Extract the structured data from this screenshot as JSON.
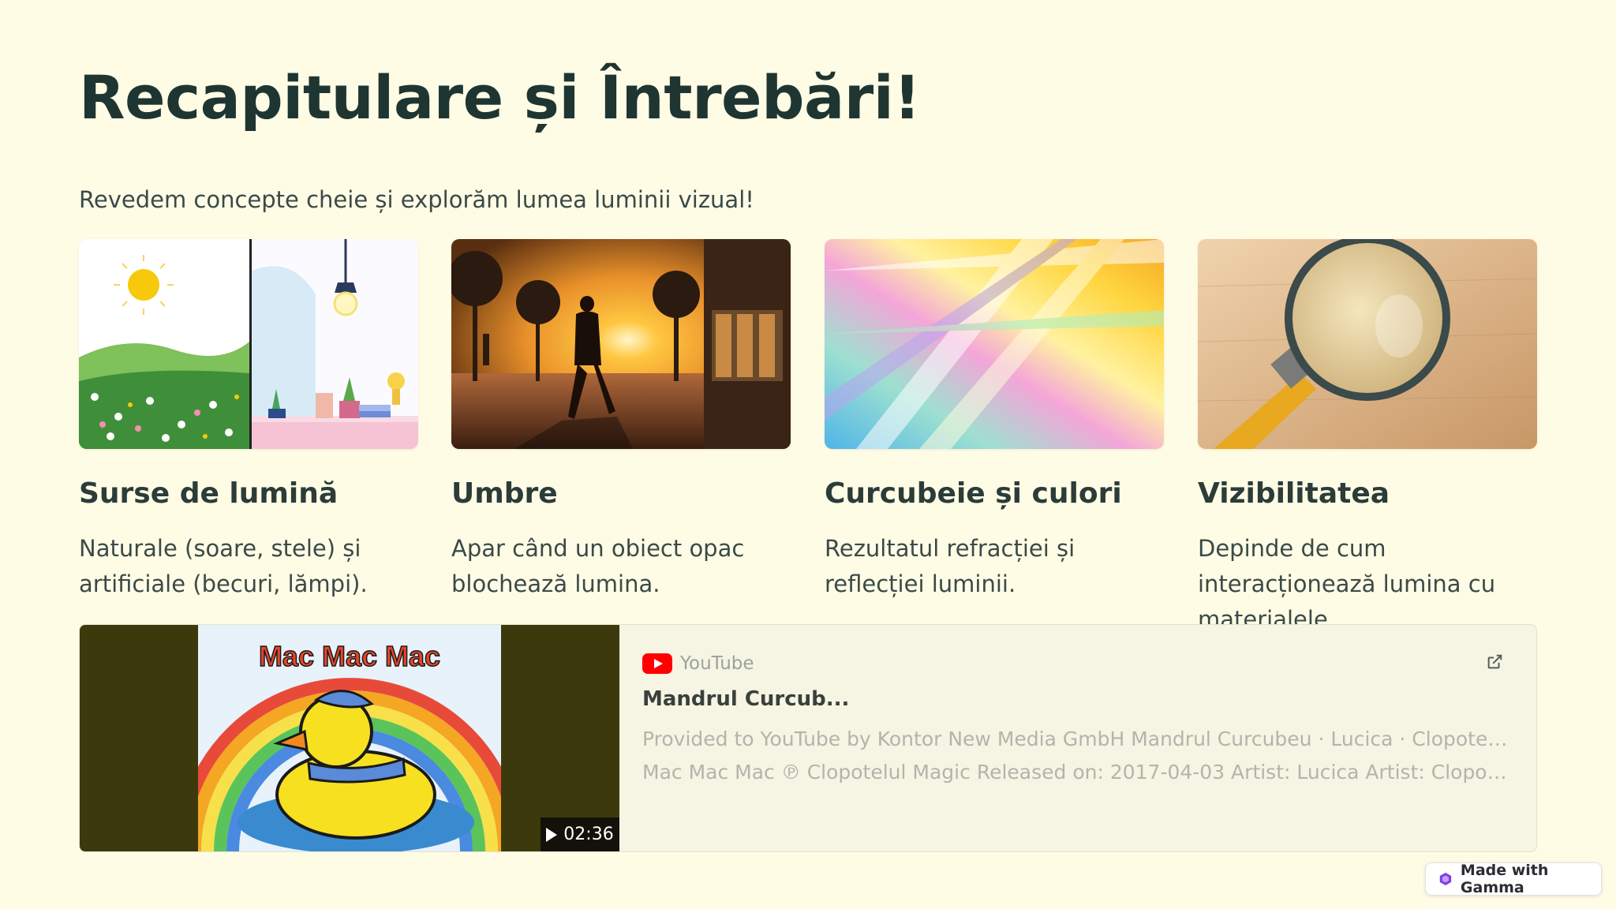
{
  "slide": {
    "title": "Recapitulare și Întrebări!",
    "subtitle": "Revedem concepte cheie și explorăm lumea luminii vizual!"
  },
  "cards": [
    {
      "heading": "Surse de lumină",
      "text": "Naturale (soare, stele) și artificiale (becuri, lămpi).",
      "image_icon": "sun-and-lamp-illustration"
    },
    {
      "heading": "Umbre",
      "text": "Apar când un obiect opac blochează lumina.",
      "image_icon": "silhouette-sunset-photo"
    },
    {
      "heading": "Curcubeie și culori",
      "text": "Rezultatul refracției și reflecției luminii.",
      "image_icon": "rainbow-light-rays"
    },
    {
      "heading": "Vizibilitatea",
      "text": "Depinde de cum interacționează lumina cu materialele.",
      "image_icon": "magnifying-glass-photo"
    }
  ],
  "embed": {
    "source": "YouTube",
    "title": "Mandrul Curcub...",
    "description_line1": "Provided to YouTube by Kontor New Media GmbH Mandrul Curcubeu · Lucica · Clopotelul Magic",
    "description_line2": "Mac Mac Mac ℗ Clopotelul Magic Released on: 2017-04-03 Artist: Lucica Artist: Clopotelul Magi...",
    "duration": "02:36",
    "thumbnail_text": "Mac Mac Mac",
    "icon_external": "external-link-icon",
    "icon_play": "play-icon"
  },
  "badge": {
    "label": "Made with Gamma",
    "icon": "gamma-logo-icon"
  },
  "colors": {
    "background": "#fffce6",
    "heading": "#1f3531",
    "embed_bg": "#f6f4e2",
    "youtube_red": "#ff0000",
    "thumb_bg": "#3c3a0c"
  }
}
